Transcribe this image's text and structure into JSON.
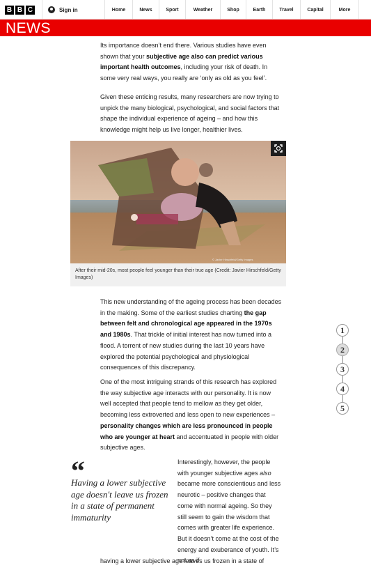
{
  "header": {
    "logo_letters": [
      "B",
      "B",
      "C"
    ],
    "signin_label": "Sign in",
    "nav": [
      "Home",
      "News",
      "Sport",
      "Weather",
      "Shop",
      "Earth",
      "Travel",
      "Capital",
      "More"
    ]
  },
  "section": {
    "title": "NEWS",
    "color": "#e90000"
  },
  "article": {
    "p1": {
      "t1": "Its importance doesn’t end there. Various studies have even shown that your ",
      "b1": "subjective age also can predict various important health outcomes",
      "t2": ", including your risk of death. In some very real ways, you really are ‘only as old as you feel’."
    },
    "p2": "Given these enticing results, many researchers are now trying to unpick the many biological, psychological, and social factors that shape the individual experience of ageing – and how this knowledge might help us live longer, healthier lives.",
    "image": {
      "caption": "After their mid-20s, most people feel younger than their true age (Credit: Javier Hirschfeld/Getty Images)",
      "overlay_credit": "© Javier Hirschfeld/Getty Images"
    },
    "p3": {
      "t1": "This new understanding of the ageing process has been decades in the making. Some of the earliest studies charting ",
      "b1": "the gap between felt and chronological age appeared in the 1970s and 1980s",
      "t2": ". That trickle of initial interest has now turned into a flood. A torrent of new studies during the last 10 years have explored the potential psychological and physiological consequences of this discrepancy."
    },
    "p4": {
      "t1": "One of the most intriguing strands of this research has explored the way subjective age interacts with our personality. It is now well accepted that people tend to mellow as they get older, becoming less extroverted and less open to new experiences – ",
      "b1": "personality changes which are less pronounced in people who are younger at heart",
      "t2": " and accentuated in people with older subjective ages."
    },
    "p5": {
      "t1": "Interestingly, however, the people with younger subjective ages ",
      "i1": "also",
      "t2": " became more conscientious and less neurotic – positive changes that come with normal ageing. So they still seem to gain the wisdom that comes with greater life experience. But it doesn’t come at the cost of the energy and exuberance of youth. It’s not as if"
    },
    "p6": "having a lower subjective age leaves us frozen in a state of",
    "pullquote": {
      "mark": "“",
      "text": "Having a lower subjective age doesn't leave us frozen in a state of permanent immaturity"
    }
  },
  "pager": {
    "pages": [
      "1",
      "2",
      "3",
      "4",
      "5"
    ],
    "active": "2"
  }
}
